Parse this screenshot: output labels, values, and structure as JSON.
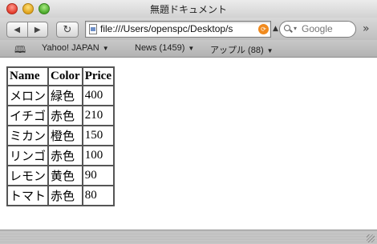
{
  "window": {
    "title": "無題ドキュメント"
  },
  "toolbar": {
    "back_icon": "back-arrow-icon",
    "forward_icon": "forward-arrow-icon",
    "reload_icon": "reload-icon",
    "url": "file:///Users/openspc/Desktop/s",
    "search_placeholder": "Google"
  },
  "bookmarks": {
    "items": [
      {
        "label": "Yahoo! JAPAN"
      },
      {
        "label": "News (1459)"
      },
      {
        "label": "アップル (88)"
      }
    ]
  },
  "table": {
    "headers": [
      "Name",
      "Color",
      "Price"
    ],
    "rows": [
      [
        "メロン",
        "緑色",
        "400"
      ],
      [
        "イチゴ",
        "赤色",
        "210"
      ],
      [
        "ミカン",
        "橙色",
        "150"
      ],
      [
        "リンゴ",
        "赤色",
        "100"
      ],
      [
        "レモン",
        "黄色",
        "90"
      ],
      [
        "トマト",
        "赤色",
        "80"
      ]
    ]
  }
}
